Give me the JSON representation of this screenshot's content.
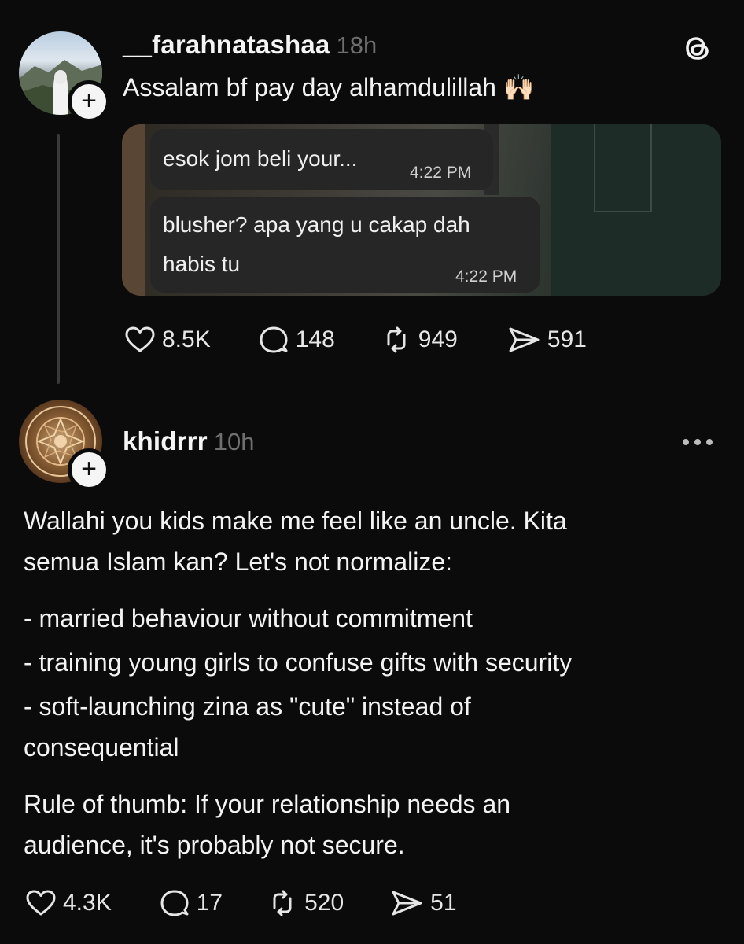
{
  "post1": {
    "username": "__farahnatashaa",
    "time": "18h",
    "text": "Assalam bf pay day alhamdulillah 🙌🏻",
    "chat_bubbles": [
      {
        "text": "esok jom beli your...",
        "time": "4:22 PM"
      },
      {
        "text_line1": "blusher? apa yang u cakap dah",
        "text_line2": "habis tu",
        "time": "4:22 PM"
      }
    ],
    "stats": {
      "likes": "8.5K",
      "replies": "148",
      "reposts": "949",
      "shares": "591"
    }
  },
  "post2": {
    "username": "khidrrr",
    "time": "10h",
    "paragraph1_line1": "Wallahi you kids make me feel like an uncle. Kita",
    "paragraph1_line2": "semua Islam kan? Let's not normalize:",
    "list_line1": "- married behaviour without commitment",
    "list_line2": "- training young girls to confuse gifts with security",
    "list_line3": "- soft-launching zina as \"cute\" instead of",
    "list_line4": "consequential",
    "paragraph2_line1": "Rule of thumb: If your relationship needs an",
    "paragraph2_line2": "audience, it's probably not secure.",
    "stats": {
      "likes": "4.3K",
      "replies": "17",
      "reposts": "520",
      "shares": "51"
    }
  },
  "follow_badge": "+",
  "icons": {
    "app_logo": "threads-logo-icon",
    "more": "more-horizontal-icon",
    "like": "heart-icon",
    "reply": "comment-icon",
    "repost": "repost-icon",
    "share": "send-icon"
  },
  "colors": {
    "background": "#0b0b0b",
    "text": "#f3f3f3",
    "muted": "#6f6f6f",
    "bubble": "#262626"
  }
}
